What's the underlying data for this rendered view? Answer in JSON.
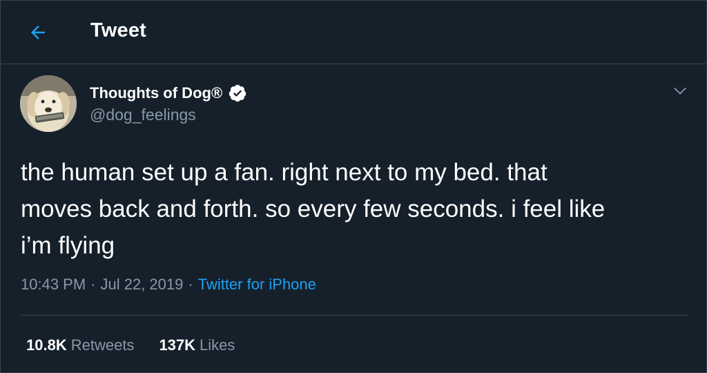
{
  "header": {
    "title": "Tweet",
    "back_icon": "arrow-left-icon"
  },
  "tweet": {
    "display_name": "Thoughts of Dog®",
    "handle": "@dog_feelings",
    "verified": true,
    "text": "the human set up a fan. right next to my bed. that\nmoves back and forth. so every few seconds. i feel like\ni’m flying",
    "time": "10:43 PM",
    "date": "Jul 22, 2019",
    "source": "Twitter for iPhone",
    "separator": "·"
  },
  "stats": {
    "retweets_count": "10.8K",
    "retweets_label": "Retweets",
    "likes_count": "137K",
    "likes_label": "Likes"
  },
  "colors": {
    "background": "#15202b",
    "border": "#38444d",
    "accent": "#1da1f2",
    "secondary_text": "#8899a6"
  }
}
